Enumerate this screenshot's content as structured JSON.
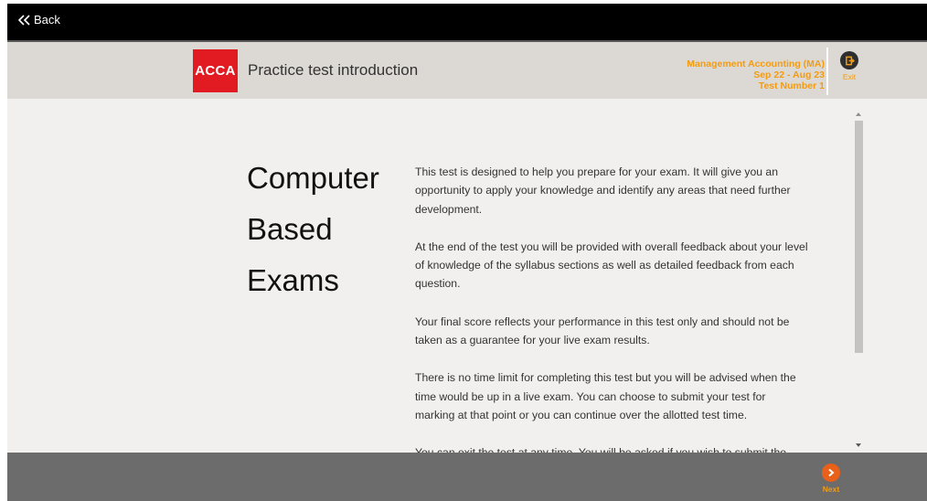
{
  "topbar": {
    "back_label": "Back"
  },
  "header": {
    "logo_text": "ACCA",
    "title": "Practice test introduction",
    "exam_name": "Management Accounting (MA)",
    "exam_period": "Sep 22 - Aug 23",
    "test_number": "Test Number 1",
    "exit_label": "Exit"
  },
  "main": {
    "heading_lines": [
      "Computer",
      "Based",
      "Exams"
    ],
    "paragraphs": [
      "This test is designed to help you prepare for your exam. It will give you an opportunity to apply your knowledge and identify any areas that need further development.",
      "At the end of the test you will be provided with overall feedback about your level of knowledge of the syllabus sections as well as detailed feedback from each question.",
      "Your final score reflects your performance in this test only and should not be taken as a guarantee for your live exam results.",
      "There is no time limit for completing this test but you will be advised when the time would be up in a live exam. You can choose to submit your test for marking at that point or you can continue over the allotted test time.",
      "You can exit the test at any time. You will be asked if you wish to submit the"
    ]
  },
  "footer": {
    "next_label": "Next"
  },
  "colors": {
    "brand_red": "#e21a22",
    "accent_orange": "#f39c12",
    "next_orange": "#e8611a"
  },
  "icons": {
    "back": "double-chevron-left-icon",
    "exit": "exit-door-icon",
    "next": "chevron-right-icon"
  }
}
